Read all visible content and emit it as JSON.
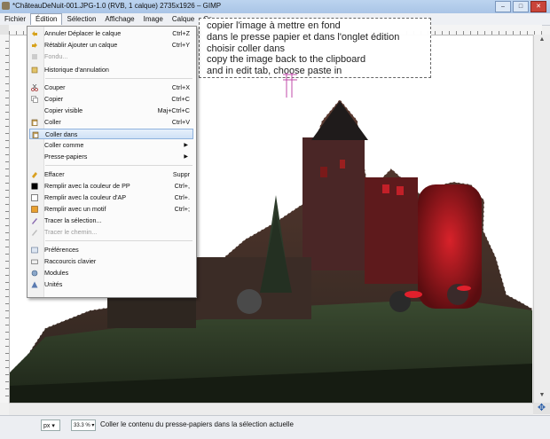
{
  "window": {
    "title": "*ChâteauDeNuit-001.JPG-1.0 (RVB, 1 calque) 2735x1926 – GIMP",
    "buttons": [
      "–",
      "□",
      "✕"
    ]
  },
  "menubar": [
    "Fichier",
    "Édition",
    "Sélection",
    "Affichage",
    "Image",
    "Calque",
    "Co"
  ],
  "edit_menu": [
    {
      "label": "Annuler Déplacer le calque",
      "shortcut": "Ctrl+Z",
      "icon": "undo-icon"
    },
    {
      "label": "Rétablir Ajouter un calque",
      "shortcut": "Ctrl+Y",
      "icon": "redo-icon"
    },
    {
      "label": "Fondu...",
      "shortcut": "",
      "icon": "fade-icon",
      "disabled": true
    },
    {
      "label": "Historique d'annulation",
      "shortcut": "",
      "icon": "history-icon"
    },
    {
      "label": "Couper",
      "shortcut": "Ctrl+X",
      "icon": "cut-icon"
    },
    {
      "label": "Copier",
      "shortcut": "Ctrl+C",
      "icon": "copy-icon"
    },
    {
      "label": "Copier visible",
      "shortcut": "Maj+Ctrl+C",
      "icon": ""
    },
    {
      "label": "Coller",
      "shortcut": "Ctrl+V",
      "icon": "paste-icon"
    },
    {
      "label": "Coller dans",
      "shortcut": "",
      "icon": "paste-into-icon",
      "highlighted": true
    },
    {
      "label": "Coller comme",
      "shortcut": "",
      "icon": "",
      "submenu": true
    },
    {
      "label": "Presse-papiers",
      "shortcut": "",
      "icon": "",
      "submenu": true
    },
    {
      "label": "Effacer",
      "shortcut": "Suppr",
      "icon": "clear-icon"
    },
    {
      "label": "Remplir avec la couleur de PP",
      "shortcut": "Ctrl+,",
      "icon": "fill-fg-icon"
    },
    {
      "label": "Remplir avec la couleur d'AP",
      "shortcut": "Ctrl+.",
      "icon": "fill-bg-icon"
    },
    {
      "label": "Remplir avec un motif",
      "shortcut": "Ctrl+;",
      "icon": "fill-pattern-icon"
    },
    {
      "label": "Tracer la sélection...",
      "shortcut": "",
      "icon": "stroke-selection-icon"
    },
    {
      "label": "Tracer le chemin...",
      "shortcut": "",
      "icon": "stroke-path-icon",
      "disabled": true
    },
    {
      "label": "Préférences",
      "shortcut": "",
      "icon": "preferences-icon"
    },
    {
      "label": "Raccourcis clavier",
      "shortcut": "",
      "icon": "keyboard-icon"
    },
    {
      "label": "Modules",
      "shortcut": "",
      "icon": "modules-icon"
    },
    {
      "label": "Unités",
      "shortcut": "",
      "icon": "units-icon"
    }
  ],
  "note_lines": [
    "copier l'image à mettre en fond",
    "dans le presse papier et dans l'onglet édition",
    "choisir coller dans",
    "copy the image back to the clipboard",
    "and in edit tab, choose paste in"
  ],
  "statusbar": {
    "unit": "px",
    "zoom": "33.3 %",
    "message": "Coller le contenu du presse-papiers dans la sélection actuelle"
  },
  "colors": {
    "accent": "#cfe1f6",
    "castle_red": "#b0141c"
  }
}
